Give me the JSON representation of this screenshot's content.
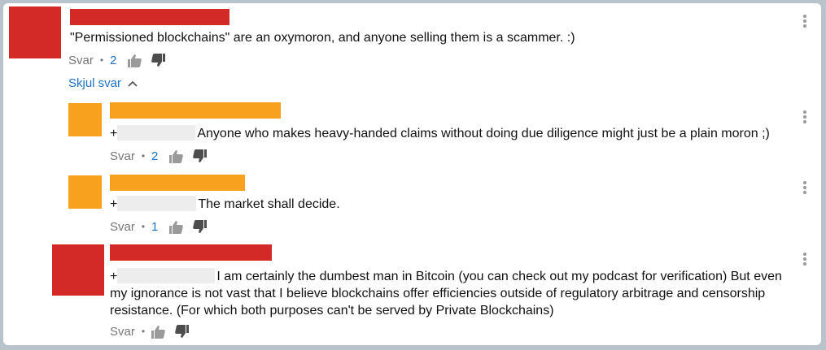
{
  "colors": {
    "red": "#d32a27",
    "orange": "#f7a11e",
    "link": "#1a73c8",
    "meta": "#767676"
  },
  "icons": {
    "thumbs_up": "thumbs-up-icon",
    "thumbs_down": "thumbs-down-icon",
    "more": "more-vert-icon",
    "chevron": "chevron-up-icon"
  },
  "comment_main": {
    "text": "\"Permissioned blockchains\" are an oxymoron, and anyone selling them is a scammer. :)",
    "reply_label": "Svar",
    "separator": "•",
    "likes": "2"
  },
  "toggle": {
    "label": "Skjul svar"
  },
  "replies": [
    {
      "mention_prefix": "+",
      "text": "Anyone who makes heavy-handed claims without doing due diligence might just be a plain moron ;)",
      "reply_label": "Svar",
      "separator": "•",
      "likes": "2"
    },
    {
      "mention_prefix": "+",
      "text": "The market shall decide.",
      "reply_label": "Svar",
      "separator": "•",
      "likes": "1"
    },
    {
      "mention_prefix": "+",
      "text": "I am certainly the dumbest man in Bitcoin (you can check out my podcast for verification) But even my ignorance is not vast that I believe blockchains offer efficiencies outside of regulatory arbitrage and censorship resistance. (For which both purposes can't be served by Private Blockchains)",
      "reply_label": "Svar",
      "separator": "•"
    }
  ]
}
